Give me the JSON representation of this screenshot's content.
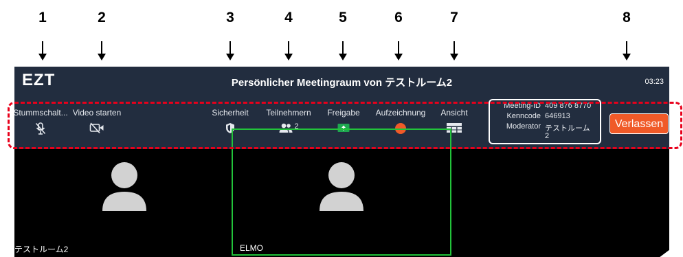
{
  "callouts": [
    "1",
    "2",
    "3",
    "4",
    "5",
    "6",
    "7",
    "8"
  ],
  "app": {
    "logo": "EZT",
    "title": "Persönlicher Meetingraum von テストルーム2",
    "clock": "03:23"
  },
  "toolbar": {
    "mute_label": "Stummschalt...",
    "video_label": "Video starten",
    "security_label": "Sicherheit",
    "participants_label": "Teilnehmern",
    "participants_count": "2",
    "share_label": "Freigabe",
    "record_label": "Aufzeichnung",
    "view_label": "Ansicht",
    "leave_label": "Verlassen"
  },
  "meeting_info": {
    "id_key": "Meeting-ID",
    "id_value": "409 876 8770",
    "passcode_key": "Kenncode",
    "passcode_value": "646913",
    "moderator_key": "Moderator",
    "moderator_value": "テストルーム",
    "moderator_value_2": "2"
  },
  "participants": [
    {
      "name": "テストルーム2"
    },
    {
      "name": "ELMO"
    }
  ],
  "colors": {
    "bar": "#222d3f",
    "leave": "#f05a28",
    "record": "#f05a28",
    "share": "#1ea84f",
    "active_speaker": "#22c33a",
    "highlight": "#e8001b"
  }
}
